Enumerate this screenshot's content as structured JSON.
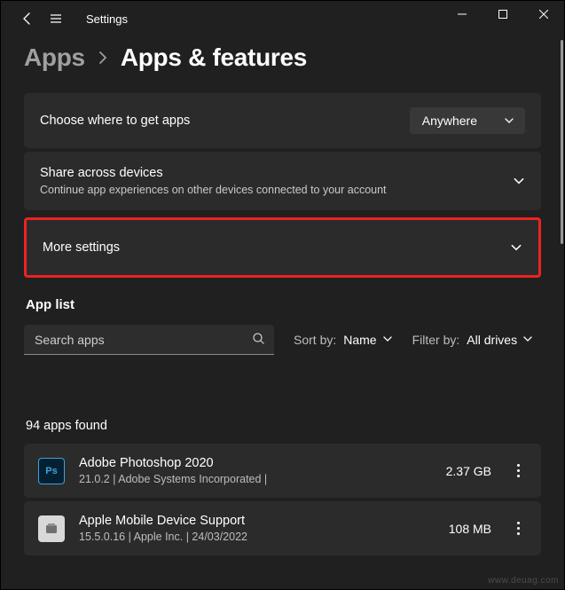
{
  "titlebar": {
    "title": "Settings"
  },
  "breadcrumb": {
    "parent": "Apps",
    "current": "Apps & features"
  },
  "cards": {
    "getApps": {
      "title": "Choose where to get apps",
      "selectValue": "Anywhere"
    },
    "share": {
      "title": "Share across devices",
      "subtitle": "Continue app experiences on other devices connected to your account"
    },
    "more": {
      "title": "More settings"
    }
  },
  "appList": {
    "heading": "App list",
    "searchPlaceholder": "Search apps",
    "sortLabel": "Sort by:",
    "sortValue": "Name",
    "filterLabel": "Filter by:",
    "filterValue": "All drives",
    "countText": "94 apps found"
  },
  "apps": [
    {
      "name": "Adobe Photoshop 2020",
      "meta": "21.0.2   |   Adobe Systems Incorporated   |",
      "size": "2.37 GB",
      "iconType": "ps"
    },
    {
      "name": "Apple Mobile Device Support",
      "meta": "15.5.0.16   |   Apple Inc.   |   24/03/2022",
      "size": "108 MB",
      "iconType": "apple"
    }
  ],
  "watermark": "www.deuag.com"
}
